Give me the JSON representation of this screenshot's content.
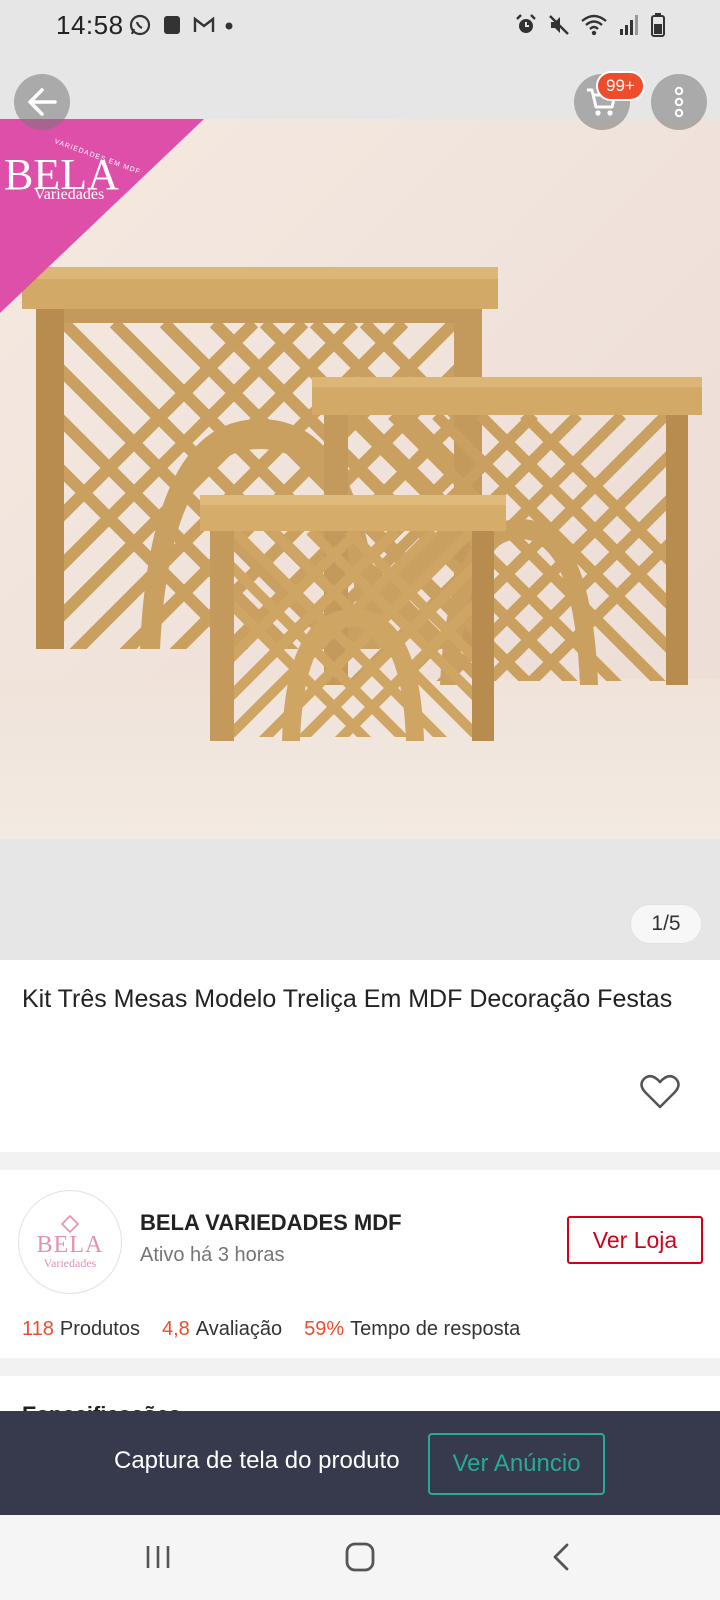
{
  "status_bar": {
    "time": "14:58",
    "left_icons": [
      "whatsapp-icon",
      "notification-box-icon",
      "gmail-icon",
      "dot-icon"
    ],
    "right_icons": [
      "alarm-icon",
      "mute-icon",
      "wifi-icon",
      "signal-icon",
      "battery-icon"
    ]
  },
  "header": {
    "cart_badge": "99+"
  },
  "gallery": {
    "brand_banner_title": "BELA",
    "brand_banner_subtitle": "Variedades",
    "brand_banner_arc": "VARIEDADES EM MDF",
    "counter": "1/5",
    "current_image": 1,
    "total_images": 5
  },
  "product": {
    "title": "Kit Três Mesas Modelo Treliça Em MDF Decoração Festas"
  },
  "shop": {
    "avatar_title": "BELA",
    "avatar_subtitle": "Variedades",
    "name": "BELA VARIEDADES MDF",
    "active_status": "Ativo há 3 horas",
    "visit_button": "Ver Loja",
    "stats": [
      {
        "value": "118",
        "label": "Produtos"
      },
      {
        "value": "4,8",
        "label": "Avaliação"
      },
      {
        "value": "59%",
        "label": "Tempo de resposta"
      }
    ]
  },
  "specs_peek": {
    "label": "Especificações"
  },
  "capture_banner": {
    "text": "Captura de tela do produto",
    "button": "Ver Anúncio"
  },
  "colors": {
    "accent": "#ee4d2d",
    "shop_button": "#d0011b",
    "banner_bg": "#363a4c",
    "banner_button": "#26aa99",
    "brand_pink": "#dd4fa8",
    "mdf_wood": "#c9a05f"
  }
}
